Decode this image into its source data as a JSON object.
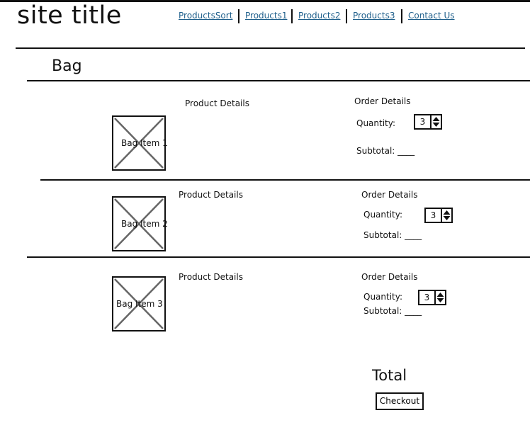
{
  "header": {
    "site_title": "site title",
    "nav": [
      {
        "label": "ProductsSort"
      },
      {
        "label": "Products1"
      },
      {
        "label": "Products2"
      },
      {
        "label": "Products3"
      },
      {
        "label": "Contact Us"
      }
    ]
  },
  "page": {
    "heading": "Bag"
  },
  "bag_items": [
    {
      "image_label": "Bag Item 1",
      "product_details": "Product Details",
      "order_details": "Order Details",
      "quantity_label": "Quantity:",
      "quantity_value": "3",
      "subtotal_label": "Subtotal: ____"
    },
    {
      "image_label": "Bag Item 2",
      "product_details": "Product Details",
      "order_details": "Order Details",
      "quantity_label": "Quantity:",
      "quantity_value": "3",
      "subtotal_label": "Subtotal: ____"
    },
    {
      "image_label": "Bag Item 3",
      "product_details": "Product Details",
      "order_details": "Order Details",
      "quantity_label": "Quantity:",
      "quantity_value": "3",
      "subtotal_label": "Subtotal: ____"
    }
  ],
  "summary": {
    "total_label": "Total",
    "checkout_label": "Checkout"
  },
  "icons": {
    "placeholder": "image-placeholder-icon",
    "stepper": "up-down-arrows-icon"
  }
}
